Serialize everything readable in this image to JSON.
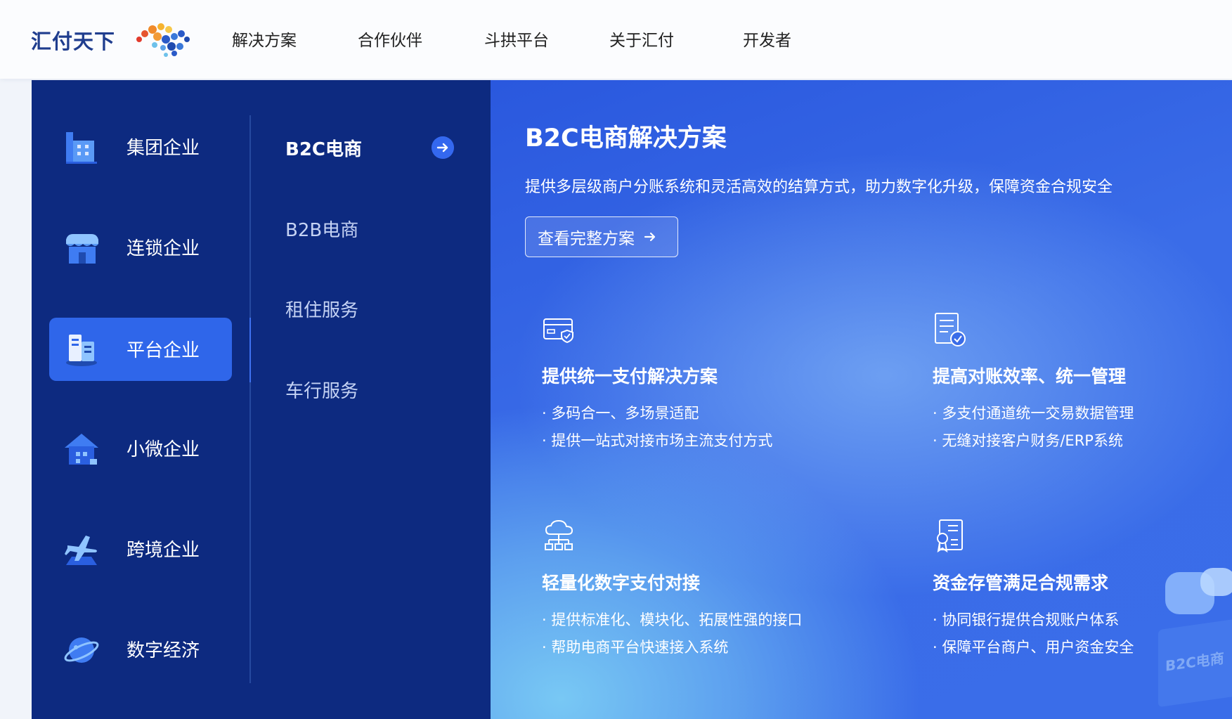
{
  "header": {
    "logo_text": "汇付天下",
    "nav": [
      {
        "label": "解决方案"
      },
      {
        "label": "合作伙伴"
      },
      {
        "label": "斗拱平台"
      },
      {
        "label": "关于汇付"
      },
      {
        "label": "开发者"
      }
    ]
  },
  "menu": {
    "categories": [
      {
        "label": "集团企业",
        "icon": "building-icon"
      },
      {
        "label": "连锁企业",
        "icon": "store-icon"
      },
      {
        "label": "平台企业",
        "icon": "platform-icon",
        "active": true
      },
      {
        "label": "小微企业",
        "icon": "small-shop-icon"
      },
      {
        "label": "跨境企业",
        "icon": "airplane-icon"
      },
      {
        "label": "数字经济",
        "icon": "planet-icon"
      }
    ],
    "subitems": [
      {
        "label": "B2C电商",
        "active": true
      },
      {
        "label": "B2B电商"
      },
      {
        "label": "租住服务"
      },
      {
        "label": "车行服务"
      }
    ]
  },
  "content": {
    "title": "B2C电商解决方案",
    "description": "提供多层级商户分账系统和灵活高效的结算方式，助力数字化升级，保障资金合规安全",
    "button_label": "查看完整方案",
    "features": [
      {
        "icon": "card-shield-icon",
        "title": "提供统一支付解决方案",
        "bullets": [
          "· 多码合一、多场景适配",
          "· 提供一站式对接市场主流支付方式"
        ]
      },
      {
        "icon": "document-check-icon",
        "title": "提高对账效率、统一管理",
        "bullets": [
          "· 多支付通道统一交易数据管理",
          "· 无缝对接客户财务/ERP系统"
        ]
      },
      {
        "icon": "cloud-network-icon",
        "title": "轻量化数字支付对接",
        "bullets": [
          "· 提供标准化、模块化、拓展性强的接口",
          "· 帮助电商平台快速接入系统"
        ]
      },
      {
        "icon": "certificate-icon",
        "title": "资金存管满足合规需求",
        "bullets": [
          "· 协同银行提供合规账户体系",
          "· 保障平台商户、用户资金安全"
        ]
      }
    ],
    "deco_text": "B2C电商"
  },
  "colors": {
    "menu_bg": "#0d2a80",
    "active_bg": "#2f66ea",
    "content_bg": "#2a58de",
    "logo_text": "#1f3d8e"
  }
}
